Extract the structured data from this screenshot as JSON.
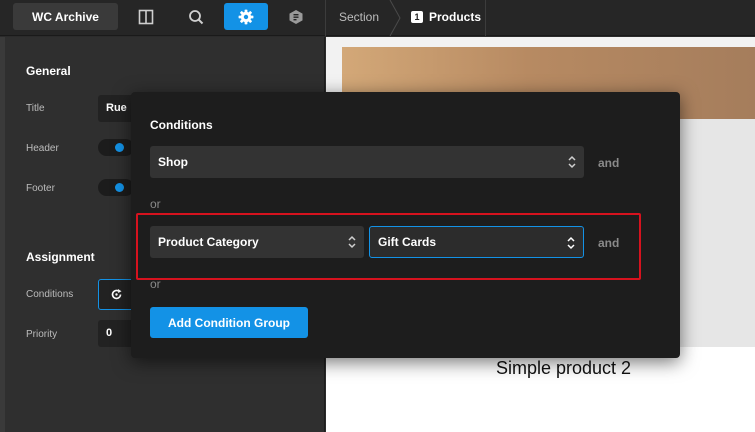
{
  "toolbar": {
    "app_title": "WC Archive",
    "icons": [
      "layout-icon",
      "search-icon",
      "gear-icon",
      "template-icon"
    ],
    "active_icon": "gear-icon"
  },
  "breadcrumb": {
    "section": "Section",
    "product_index": "1",
    "products": "Products"
  },
  "sidebar": {
    "general_heading": "General",
    "title_label": "Title",
    "title_value": "Rue",
    "header_label": "Header",
    "footer_label": "Footer",
    "assignment_heading": "Assignment",
    "conditions_label": "Conditions",
    "priority_label": "Priority",
    "priority_value": "0"
  },
  "canvas": {
    "product_title": "Simple product 2"
  },
  "conditions_popover": {
    "title": "Conditions",
    "group1": {
      "type": "Shop",
      "joiner": "and"
    },
    "separator1": "or",
    "group2": {
      "type": "Product Category",
      "value": "Gift Cards",
      "joiner": "and"
    },
    "separator2": "or",
    "add_group_label": "Add Condition Group"
  },
  "colors": {
    "accent": "#1392e6",
    "highlight": "#d6121e",
    "popover_bg": "#1d1d1d",
    "panel_bg": "#2f2f2f"
  }
}
